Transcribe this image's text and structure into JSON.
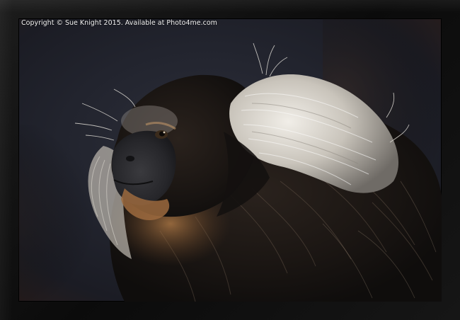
{
  "photo": {
    "subject": "marmoset-icon",
    "caption": "Copyright © Sue Knight 2015. Available at Photo4me.com"
  },
  "colors": {
    "frame": "#111111",
    "background": "#262833",
    "fur_dark": "#1a1614",
    "fur_tan": "#9c6a3e",
    "ear_tuft": "#d8d4cc"
  }
}
